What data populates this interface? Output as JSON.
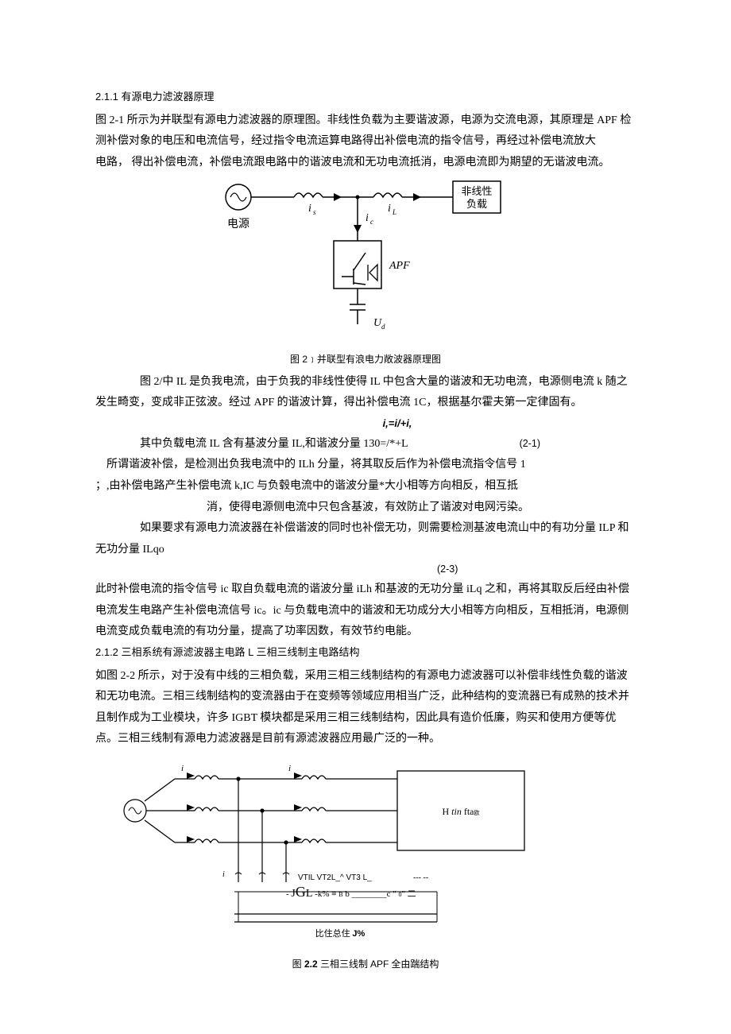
{
  "section211": {
    "heading": "2.1.1  有源电力滤波器原理",
    "p1": "图 2-1 所示为并联型有源电力滤波器的原理图。非线性负载为主要谐波源，电源为交流电源，其原理是 APF 检测补偿对象的电压和电流信号，经过指令电流运算电路得出补偿电流的指令信号，再经过补偿电流放大",
    "p2_pre": "电路， 得出补偿电流，补偿电流跟电路中的谐波电流和无功电流抵消，电源电流即为期望的无谐波电流。"
  },
  "fig1": {
    "labels": {
      "source": "电源",
      "load1": "非线性",
      "load2": "负载",
      "is": "i",
      "il": "i",
      "ic": "i",
      "apf": "APF",
      "ud": "U"
    },
    "caption_prefix": "图 2",
    "caption_rest": "﹞并联型有浪电力敞波器原理图"
  },
  "after_fig1": {
    "p1": "图 2/中 IL 是负我电流，由于负我的非线性使得 IL 中包含大量的谐波和无功电流，电源侧电流 k 随之发生畸变，变成非正弦波。经过 APF 的谐波计算，得出补偿电流 1C，根据基尔霍夫第一定律固有。",
    "formula1": "i,=i/+i,",
    "line2_text": "其中负载电流 IL 含有基波分量 IL,和谐波分量 130=/*+L",
    "eq21": "(2-1)",
    "p2": "所谓谐波补偿，是检测出负我电流中的 ILh 分量，将其取反后作为补偿电流指令信号 1",
    "p3": "；,由补偿电路产生补偿电流 k,IC 与负毂电流中的谐波分量*大小相等方向相反，相互抵",
    "p4": "消，使得电源侧电流中只包含基波，有效防止了谐波对电网污染。",
    "p5": "如果要求有源电力流波器在补偿谐波的同时也补偿无功，则需要检测基波电流山中的有功分量 ILP 和无功分量 ILqo",
    "eq23": "(2-3)",
    "p6": "此时补偿电流的指令信号 ic 取自负载电流的谐波分量 iLh 和基波的无功分量 iLq 之和，再将其取反后经由补偿电流发生电路产生补偿电流信号 ic。ic 与负载电流中的谐波和无功成分大小相等方向相反，互相抵消，电源侧电流变成负载电流的有功分量，提高了功率因数，有效节约电能。"
  },
  "section212": {
    "heading": "2.1.2  三相系统有源滤波器主电路 L 三相三线制主电路结构",
    "p1": "如图 2-2 所示，对于没有中线的三相负载，采用三相三线制结构的有源电力滤波器可以补偿非线性负载的谐波和无功电流。三相三线制结构的变流器由于在变频等领域应用相当广泛，此种结构的变流器已有成熟的技术并且制作成为工业模块，许多 IGBT 模块都是采用三相三线制结构，因此具有造价低廉，购买和使用方便等优点。三相三线制有源电力滤波器是目前有源滤波器应用最广泛的一种。"
  },
  "fig2": {
    "right_label": "H tin fta",
    "vt_row": "VTIL  VT2L_^ VT3 L_",
    "mid_row_a": "- ",
    "mid_row_b": "J",
    "mid_row_c": "G",
    "mid_row_d": "L",
    "mid_row_e": " -k% ≡ B b  ________c  \" 0\" 二",
    "bottom_label": "比住总住 J%",
    "caption": "图 2.2 三相三线制 APF 全由踹结构"
  }
}
